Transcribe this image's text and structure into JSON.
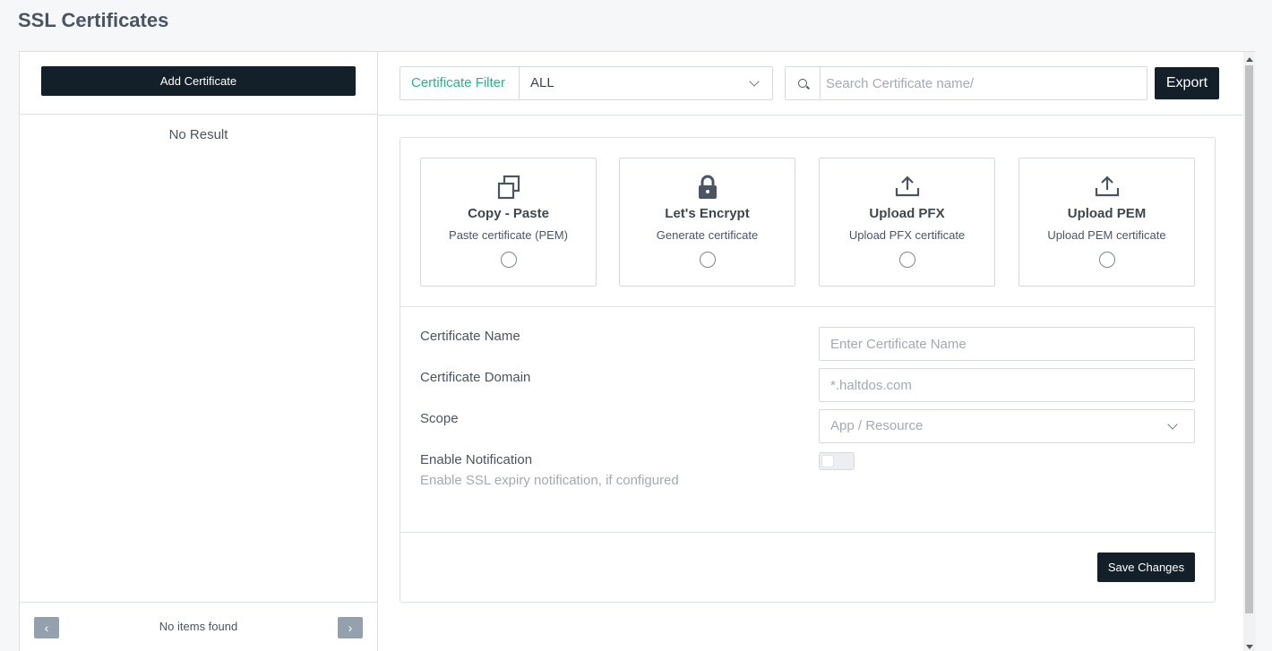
{
  "page": {
    "title": "SSL Certificates"
  },
  "left_panel": {
    "add_button_label": "Add Certificate",
    "empty_text": "No Result",
    "pager": {
      "prev": "‹",
      "next": "›",
      "status": "No items found"
    }
  },
  "toolbar": {
    "filter_label": "Certificate Filter",
    "filter_value": "ALL",
    "search_placeholder": "Search Certificate name/",
    "export_label": "Export"
  },
  "options": [
    {
      "title": "Copy - Paste",
      "subtitle": "Paste certificate (PEM)",
      "icon": "copy-icon"
    },
    {
      "title": "Let's Encrypt",
      "subtitle": "Generate certificate",
      "icon": "lock-icon"
    },
    {
      "title": "Upload PFX",
      "subtitle": "Upload PFX certificate",
      "icon": "upload-icon"
    },
    {
      "title": "Upload PEM",
      "subtitle": "Upload PEM certificate",
      "icon": "upload-icon"
    }
  ],
  "form": {
    "name_label": "Certificate Name",
    "name_placeholder": "Enter Certificate Name",
    "domain_label": "Certificate Domain",
    "domain_placeholder": "*.haltdos.com",
    "scope_label": "Scope",
    "scope_placeholder": "App / Resource",
    "notify_label": "Enable Notification",
    "notify_sublabel": "Enable SSL expiry notification, if configured",
    "notify_enabled": false
  },
  "save_label": "Save Changes",
  "colors": {
    "primary_dark": "#13202a",
    "accent_green": "#2fb08c",
    "pager_gray": "#93a0ad"
  }
}
